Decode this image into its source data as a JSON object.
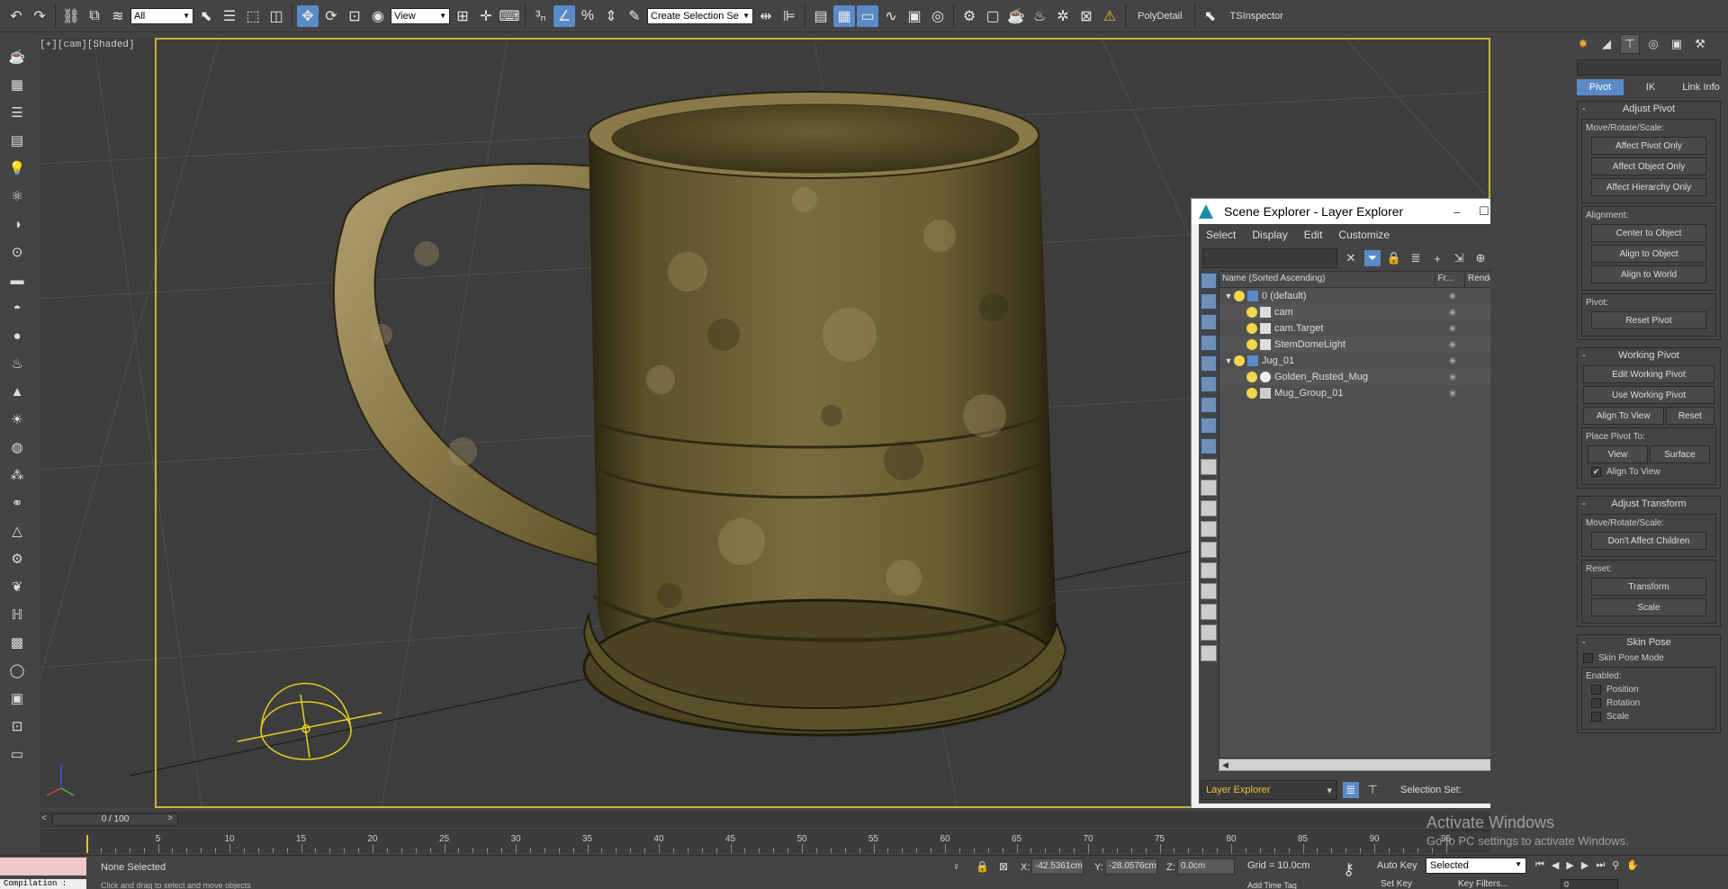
{
  "toolbar": {
    "selection_filter": "All",
    "ref_coord_system": "View",
    "named_selection_set": "Create Selection Se",
    "plugin_poly_detail": "PolyDetail",
    "plugin_ts_inspector": "TSInspector",
    "icons": [
      "undo-icon",
      "redo-icon",
      "link-icon",
      "unlink-icon",
      "bind-space-warp-icon",
      "select-object-icon",
      "select-by-name-icon",
      "rectangular-region-icon",
      "window-crossing-icon",
      "select-and-move-icon",
      "select-and-rotate-icon",
      "select-and-scale-icon",
      "select-and-place-icon",
      "snap-toggle-icon",
      "angle-snap-icon",
      "percent-snap-icon",
      "spinner-snap-icon",
      "edit-named-sets-icon",
      "mirror-icon",
      "align-icon",
      "layer-explorer-icon",
      "scene-explorer-icon",
      "curve-editor-icon",
      "schematic-view-icon",
      "material-editor-icon",
      "render-setup-icon",
      "rendered-frame-window-icon",
      "render-icon",
      "warning-icon"
    ]
  },
  "viewport": {
    "label": "[+][cam][Shaded]",
    "frame_color": "#c8b43a"
  },
  "scene_explorer": {
    "title": "Scene Explorer - Layer Explorer",
    "menu": [
      "Select",
      "Display",
      "Edit",
      "Customize"
    ],
    "columns": [
      "Name (Sorted Ascending)",
      "Fr...",
      "Renderable"
    ],
    "rows": [
      {
        "name": "0 (default)",
        "level": 0,
        "expander": "▼",
        "type": "layer"
      },
      {
        "name": "cam",
        "level": 1,
        "expander": "",
        "type": "camera"
      },
      {
        "name": "cam.Target",
        "level": 1,
        "expander": "",
        "type": "camera"
      },
      {
        "name": "StemDomeLight",
        "level": 1,
        "expander": "",
        "type": "light"
      },
      {
        "name": "Jug_01",
        "level": 0,
        "expander": "▼",
        "type": "layer"
      },
      {
        "name": "Golden_Rusted_Mug",
        "level": 1,
        "expander": "",
        "type": "geometry"
      },
      {
        "name": "Mug_Group_01",
        "level": 1,
        "expander": "",
        "type": "group"
      }
    ],
    "freeze_glyph": "✳",
    "layer_dropdown": "Layer Explorer",
    "selection_set_label": "Selection Set:"
  },
  "command_panel": {
    "subtabs": [
      "Pivot",
      "IK",
      "Link Info"
    ],
    "adjust_pivot": {
      "title": "Adjust Pivot",
      "move_label": "Move/Rotate/Scale:",
      "buttons": [
        "Affect Pivot Only",
        "Affect Object Only",
        "Affect Hierarchy Only"
      ],
      "alignment_label": "Alignment:",
      "align_buttons": [
        "Center to Object",
        "Align to Object",
        "Align to World"
      ],
      "pivot_label": "Pivot:",
      "reset_pivot": "Reset Pivot"
    },
    "working_pivot": {
      "title": "Working Pivot",
      "edit": "Edit Working Pivot",
      "use": "Use Working Pivot",
      "align_to_view": "Align To View",
      "reset": "Reset",
      "place_label": "Place Pivot To:",
      "view": "View",
      "surface": "Surface",
      "align_check": "Align To View",
      "align_checked": true
    },
    "adjust_transform": {
      "title": "Adjust Transform",
      "move_label": "Move/Rotate/Scale:",
      "dont_affect": "Don't Affect Children",
      "reset_label": "Reset:",
      "transform": "Transform",
      "scale": "Scale"
    },
    "skin_pose": {
      "title": "Skin Pose",
      "skin_pose_mode": "Skin Pose Mode",
      "enabled_label": "Enabled:",
      "options": [
        "Position",
        "Rotation",
        "Scale"
      ]
    }
  },
  "timeline": {
    "frame_display": "0 / 100",
    "ticks": [
      "5",
      "10",
      "15",
      "20",
      "25",
      "30",
      "35",
      "40",
      "45",
      "50",
      "55",
      "60",
      "65",
      "70",
      "75",
      "80",
      "85",
      "90",
      "95"
    ]
  },
  "status": {
    "selection": "None Selected",
    "hint": "Click and drag to select and move objects",
    "compilation": "Compilation :",
    "x_label": "X:",
    "x_value": "-42.5361cm",
    "y_label": "Y:",
    "y_value": "-28.0576cm",
    "z_label": "Z:",
    "z_value": "0.0cm",
    "grid": "Grid = 10.0cm",
    "auto_key": "Auto Key",
    "set_key": "Set Key",
    "selected": "Selected",
    "key_filters": "Key Filters...",
    "add_time_tag": "Add Time Tag",
    "frame_field": "0"
  },
  "watermark": {
    "line1": "Activate Windows",
    "line2": "Go to PC settings to activate Windows."
  }
}
